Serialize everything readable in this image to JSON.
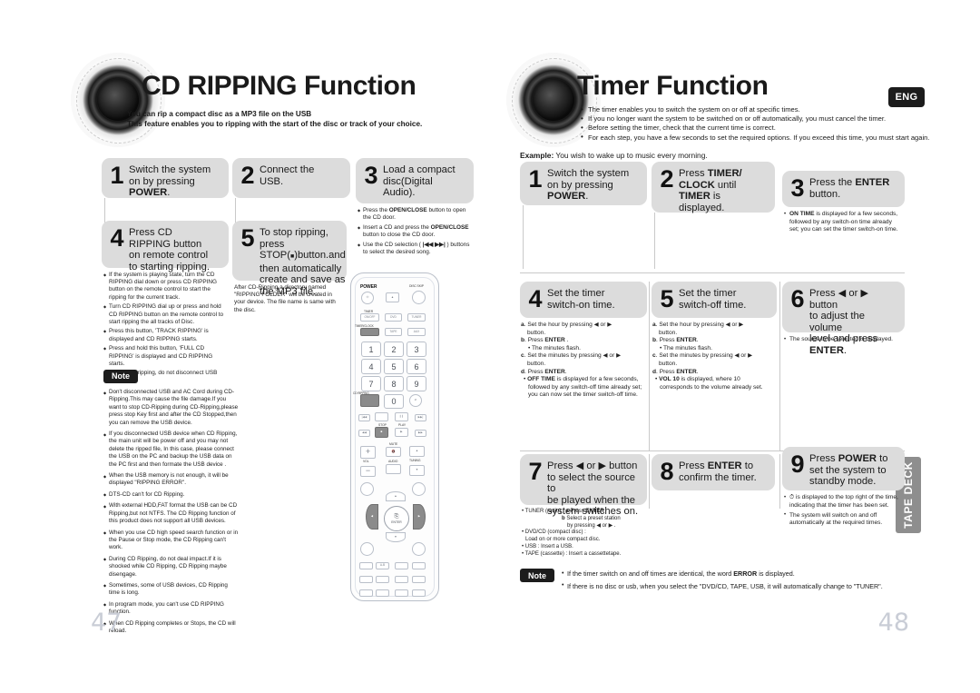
{
  "left_page": {
    "number": "47",
    "title": "CD RIPPING Function",
    "subtitle_line1": "You can rip a compact disc as a MP3 file on the USB",
    "subtitle_line2": "This feature enables you to ripping with the start of the disc or track of your choice.",
    "steps": [
      {
        "num": "1",
        "text_parts": [
          "Switch the system on by pressing ",
          "POWER",
          "."
        ],
        "body": []
      },
      {
        "num": "2",
        "text_parts": [
          "Connect the USB.",
          "",
          ""
        ],
        "body": []
      },
      {
        "num": "3",
        "text_parts": [
          "Load a compact disc(Digital Audio).",
          "",
          ""
        ],
        "body": [
          "Press the OPEN/CLOSE button to open the CD door.",
          "Insert a CD and press the OPEN/CLOSE button to close the CD door.",
          "Use the CD selection ( |◀◀  ▶▶| ) buttons to select the desired song."
        ]
      },
      {
        "num": "4",
        "text_parts": [
          "Press CD RIPPING button on remote control to starting ripping.",
          "",
          ""
        ],
        "body": [
          "If the system is playing state, turn the CD RIPPING dial down or press CD RIPPING button on the remote control to start the ripping for the current track.",
          "Turn CD RIPPING dial up or press and hold CD RIPPING button on the remote control to start ripping the all tracks of Disc.",
          "Press this button, 'TRACK RIPPING' is displayed and CD RIPPING starts.",
          "Press and hold this button, 'FULL CD RIPPING' is displayed and CD RIPPING starts.",
          "During CD ripping, do not disconnect USB device."
        ]
      },
      {
        "num": "5",
        "text_parts": [
          "To stop ripping, press STOP(■)button.and then automatically create and save as the MP3 file.",
          "",
          ""
        ],
        "body_plain": "After CD-Ripping,a directory named \"RIPPING FOLDER\" will be created in your device. The file name is same with the disc."
      }
    ],
    "note": {
      "label": "Note",
      "items": [
        "Don't disconnected USB and AC Cord  during CD-Ripping.This may cause the file damage.If you want to stop CD-Ripping during CD-Ripping,please press stop Key first and after the CD Stopped,then you can remove the USB device.",
        "If you disconnected USB device when CD Ripping, the main unit will be power off and you may not delete the ripped file, In this case, please connect the USB on the PC and backup the USB data on the PC first and then formate the USB device .",
        "When the USB memory is not enough, it will be displayed \"RIPPING ERROR\".",
        "DTS-CD can't for CD Ripping.",
        "With external HDD,FAT format the USB can be CD Ripping,but not NTFS. The CD Ripping function of this product does not support all USB devices.",
        "When you use CD high speed search function or in the Pause or Stop mode, the CD Ripping can't work.",
        "During CD Ripping, do not deal impact.If it is shocked while CD Ripping, CD Ripping maybe disengage.",
        "Sometimes, some of USB devices, CD Ripping time is long.",
        "In program mode, you can't use CD RIPPING function.",
        "When CD Ripping completes or Stops, the CD will reload."
      ]
    }
  },
  "right_page": {
    "number": "48",
    "title": "Timer Function",
    "eng_badge": "ENG",
    "side_tab": "TAPE DECK",
    "bullets": [
      "The timer enables you to switch the system on or off at specific times.",
      "If you no longer want the system to be switched on or off automatically, you must cancel the timer.",
      "Before setting the timer, check that the current time is correct.",
      "For each step, you have a few seconds to set the required options. If you exceed this time, you must start again."
    ],
    "example_label": "Example:",
    "example_text": " You wish to wake up to music every morning.",
    "steps": [
      {
        "num": "1",
        "text_html": "Switch the system on by pressing <b>POWER</b>.",
        "body": []
      },
      {
        "num": "2",
        "text_html": "Press <b>TIMER/ CLOCK</b> until <b>TIMER</b> is displayed.",
        "body": []
      },
      {
        "num": "3",
        "text_html": "Press the <b>ENTER</b> button.",
        "body": [
          "<b>ON TIME</b> is displayed for a few seconds, followed by any switch-on time already set; you can set the timer switch-on time."
        ]
      },
      {
        "num": "4",
        "text_html": "Set the timer switch-on time.",
        "sublist": [
          "<b>a</b>. Set the hour by pressing ◀ or ▶ button.",
          "<b>b</b>. Press <b>ENTER</b> .",
          "• The minutes flash.",
          "<b>c</b>. Set the minutes by pressing ◀ or ▶ button.",
          "<b>d</b>. Press <b>ENTER</b>.",
          "• <b>OFF TIME</b> is displayed for a few seconds, followed by any switch-off time already set; you can now set the timer switch-off time."
        ]
      },
      {
        "num": "5",
        "text_html": "Set the timer switch-off time.",
        "sublist": [
          "<b>a</b>. Set the hour by pressing ◀ or ▶ button.",
          "<b>b</b>. Press <b>ENTER</b>.",
          "• The minutes flash.",
          "<b>c</b>. Set the minutes by pressing ◀ or ▶ button.",
          "<b>d</b>. Press <b>ENTER</b>.",
          "• <b>VOL 10</b> is displayed, where 10 corresponds to the volume already set."
        ]
      },
      {
        "num": "6",
        "text_html": "Press ◀ or ▶ button to adjust the volume level and press <b>ENTER</b>.",
        "body": [
          "The source to be selected is displayed."
        ]
      },
      {
        "num": "7",
        "text_html": "Press ◀ or ▶ button to select the source to be played when the system switches on.",
        "sublist": [
          "• TUNER (radio) : <b>a</b> Press <b>ENTER</b>",
          "<b>b</b> Select a preset station by pressing ◀ or ▶ .",
          "• DVD/CD (compact disc) :",
          "Load on or more compact disc.",
          "• USB : Insert a USB.",
          "• TAPE (cassette) :  Insert a cassettetape."
        ]
      },
      {
        "num": "8",
        "text_html": "Press <b>ENTER</b> to confirm the timer.",
        "body": []
      },
      {
        "num": "9",
        "text_html": "Press <b>POWER</b> to set the system to standby mode.",
        "body": [
          "⌚ is displayed to the top right of the time, indicating that the timer has been set.",
          "The system will switch on and off automatically at the required times."
        ]
      }
    ],
    "note": {
      "label": "Note",
      "items": [
        "If the timer switch on and off times are identical, the word <b>ERROR</b> is displayed.",
        "If there is no disc or usb, when you select the \"DVD/CD, TAPE, USB, it will automatically change to \"TUNER\"."
      ]
    }
  },
  "remote": {
    "name": "remote-control-illustration",
    "labels": {
      "power": "POWER",
      "disc_skip": "DISC SKIP",
      "timer": "TIMER",
      "on_off": "ON/OFF",
      "timer_clock": "TIMER/CLOCK",
      "dvd": "DVD",
      "tuner": "TUNER",
      "tape": "TAPE",
      "aux": "AUX",
      "cd_ripping": "CD RIPPING",
      "vol": "VOL",
      "tuning": "TUNING",
      "mute": "MUTE",
      "audio": "AUDIO",
      "enter": "ENTER",
      "stop": "STOP",
      "play": "PLAY",
      "pause": "PAUSE",
      "cancel": "CANCEL"
    },
    "numbers": [
      "1",
      "2",
      "3",
      "4",
      "5",
      "6",
      "7",
      "8",
      "9",
      "0"
    ]
  },
  "colors": {
    "step_head_bg": "#dcdcdc",
    "badge_bg": "#1c1c1c",
    "side_tab_bg": "#8e8e8e",
    "page_number": "#c9cdd6",
    "rule": "#c9c9c9"
  }
}
